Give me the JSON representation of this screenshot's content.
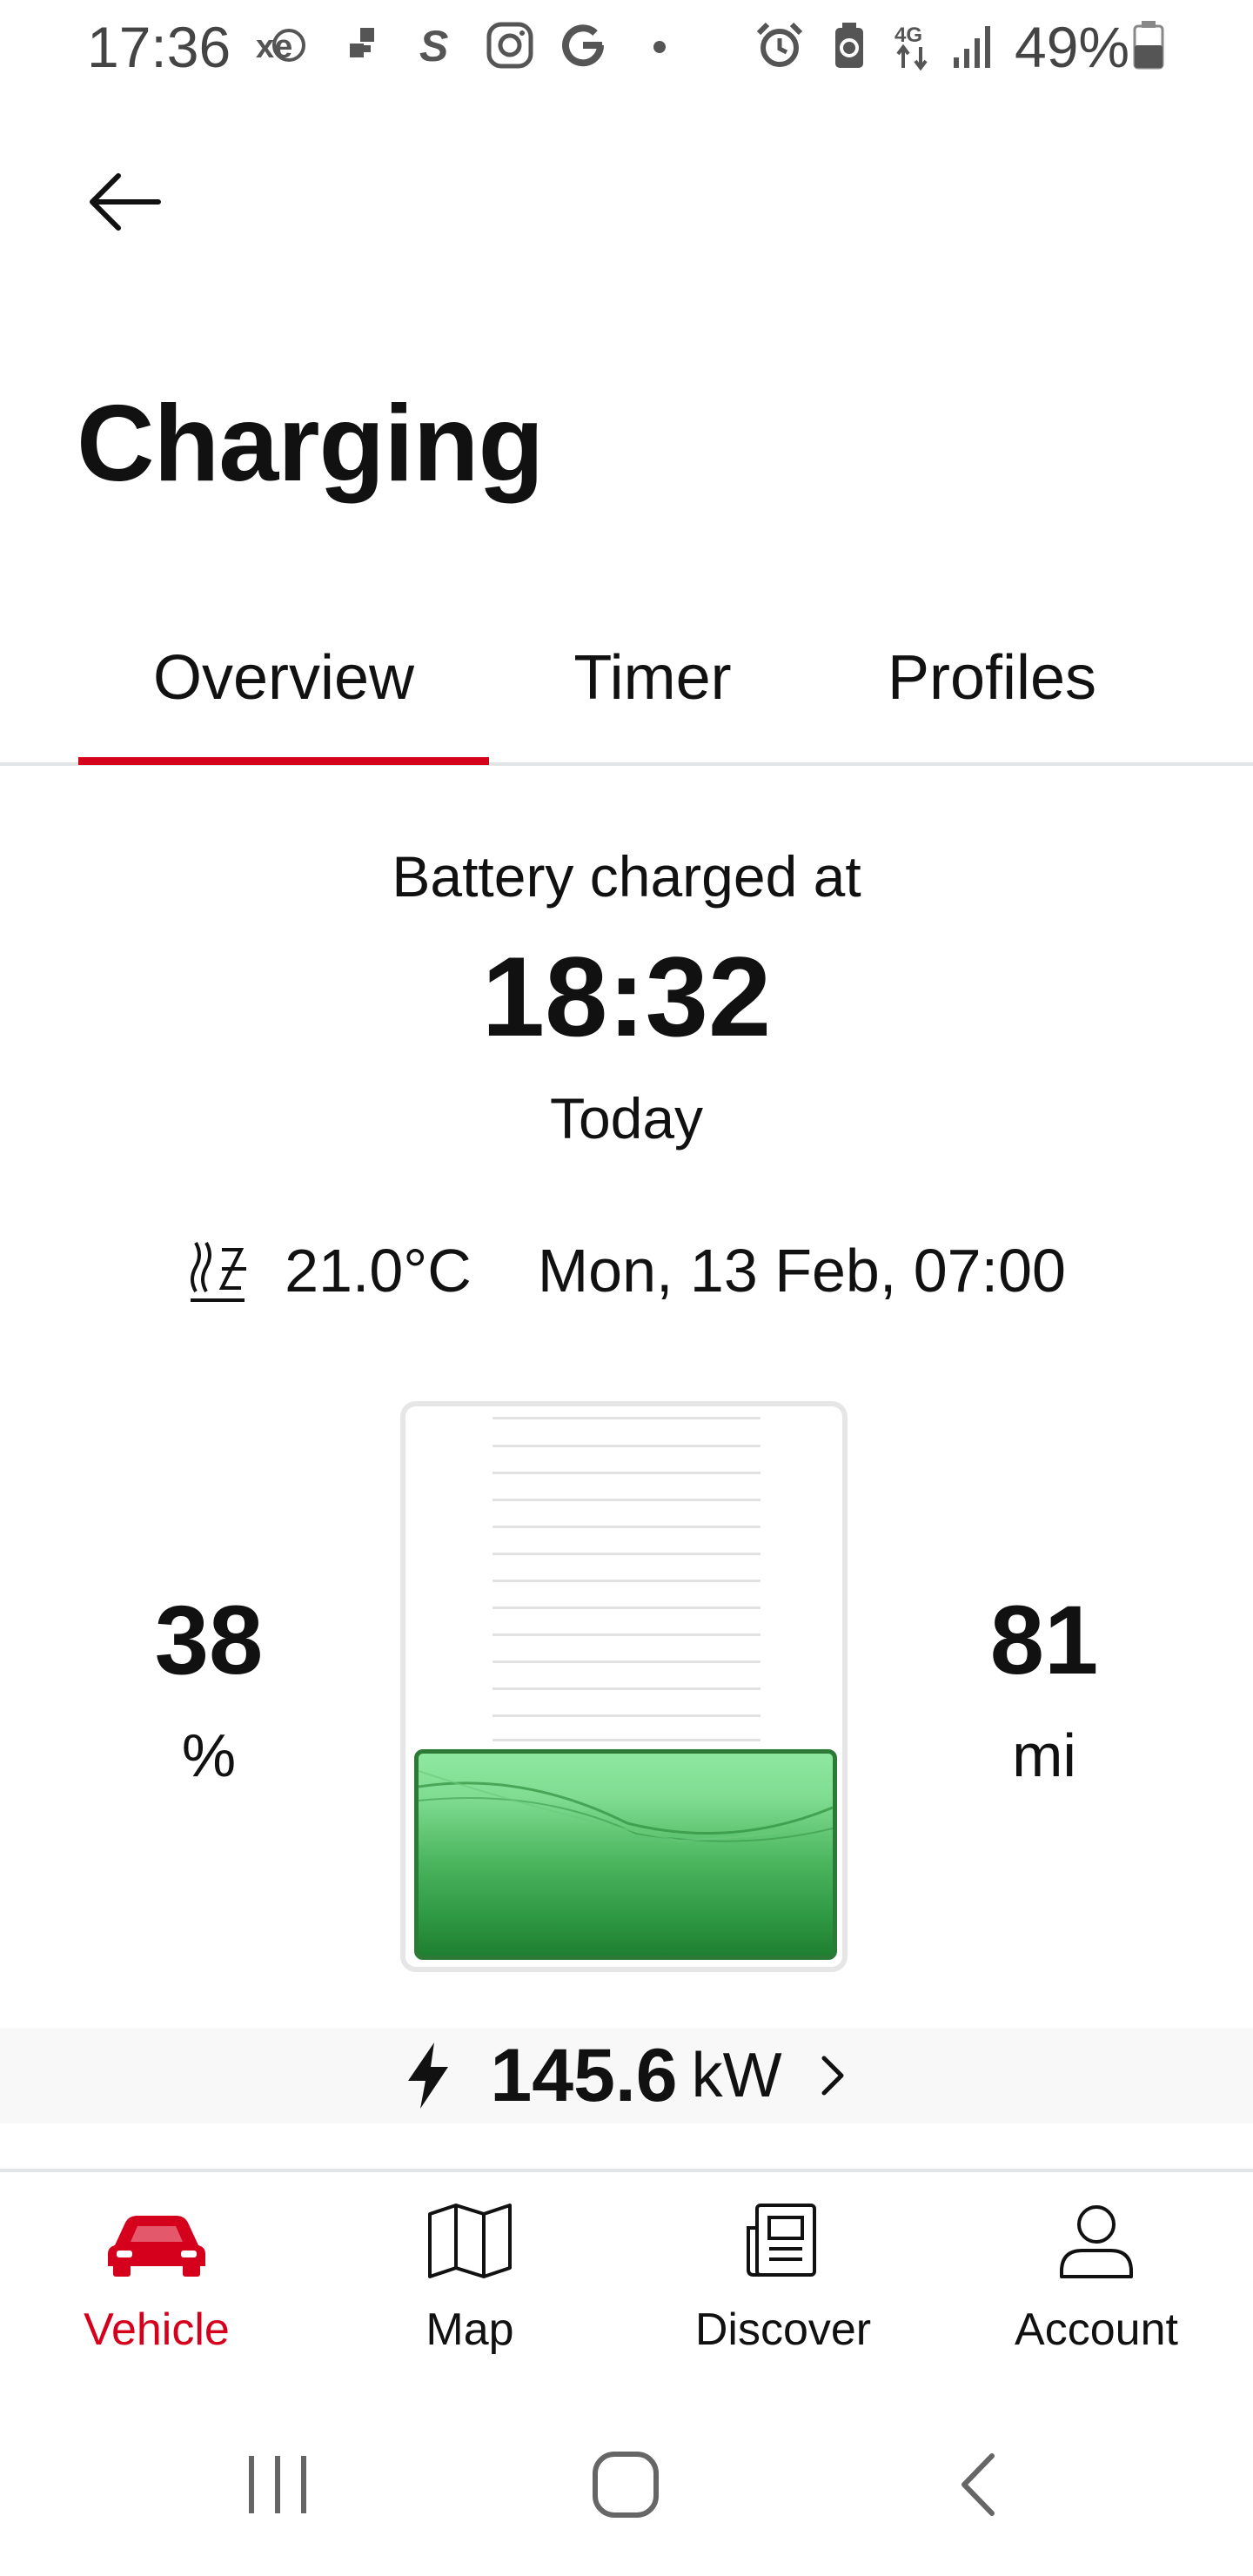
{
  "status_bar": {
    "time": "17:36",
    "battery_percent": "49%",
    "icons": [
      "xe-icon",
      "slack-icon",
      "s-icon",
      "instagram-icon",
      "google-icon",
      "dot-icon",
      "alarm-icon",
      "battery-saver-icon",
      "4g-icon",
      "signal-icon",
      "battery-icon"
    ]
  },
  "header": {
    "title": "Charging"
  },
  "tabs": [
    {
      "label": "Overview",
      "active": true
    },
    {
      "label": "Timer",
      "active": false
    },
    {
      "label": "Profiles",
      "active": false
    }
  ],
  "status": {
    "charged_label": "Battery charged at",
    "charged_time": "18:32",
    "charged_day": "Today"
  },
  "climate": {
    "temperature": "21.0°C",
    "departure": "Mon, 13 Feb, 07:00"
  },
  "battery": {
    "soc_value": "38",
    "soc_unit": "%",
    "range_value": "81",
    "range_unit": "mi",
    "level_fraction": 0.38
  },
  "power": {
    "value": "145.6",
    "unit": "kW"
  },
  "bottom_nav": {
    "items": [
      {
        "label": "Vehicle",
        "icon": "car-icon",
        "active": true
      },
      {
        "label": "Map",
        "icon": "map-icon",
        "active": false
      },
      {
        "label": "Discover",
        "icon": "newspaper-icon",
        "active": false
      },
      {
        "label": "Account",
        "icon": "user-icon",
        "active": false
      }
    ]
  },
  "colors": {
    "accent": "#d5001c",
    "battery_fill": "#5cc46f",
    "battery_border": "#2c7a36"
  }
}
